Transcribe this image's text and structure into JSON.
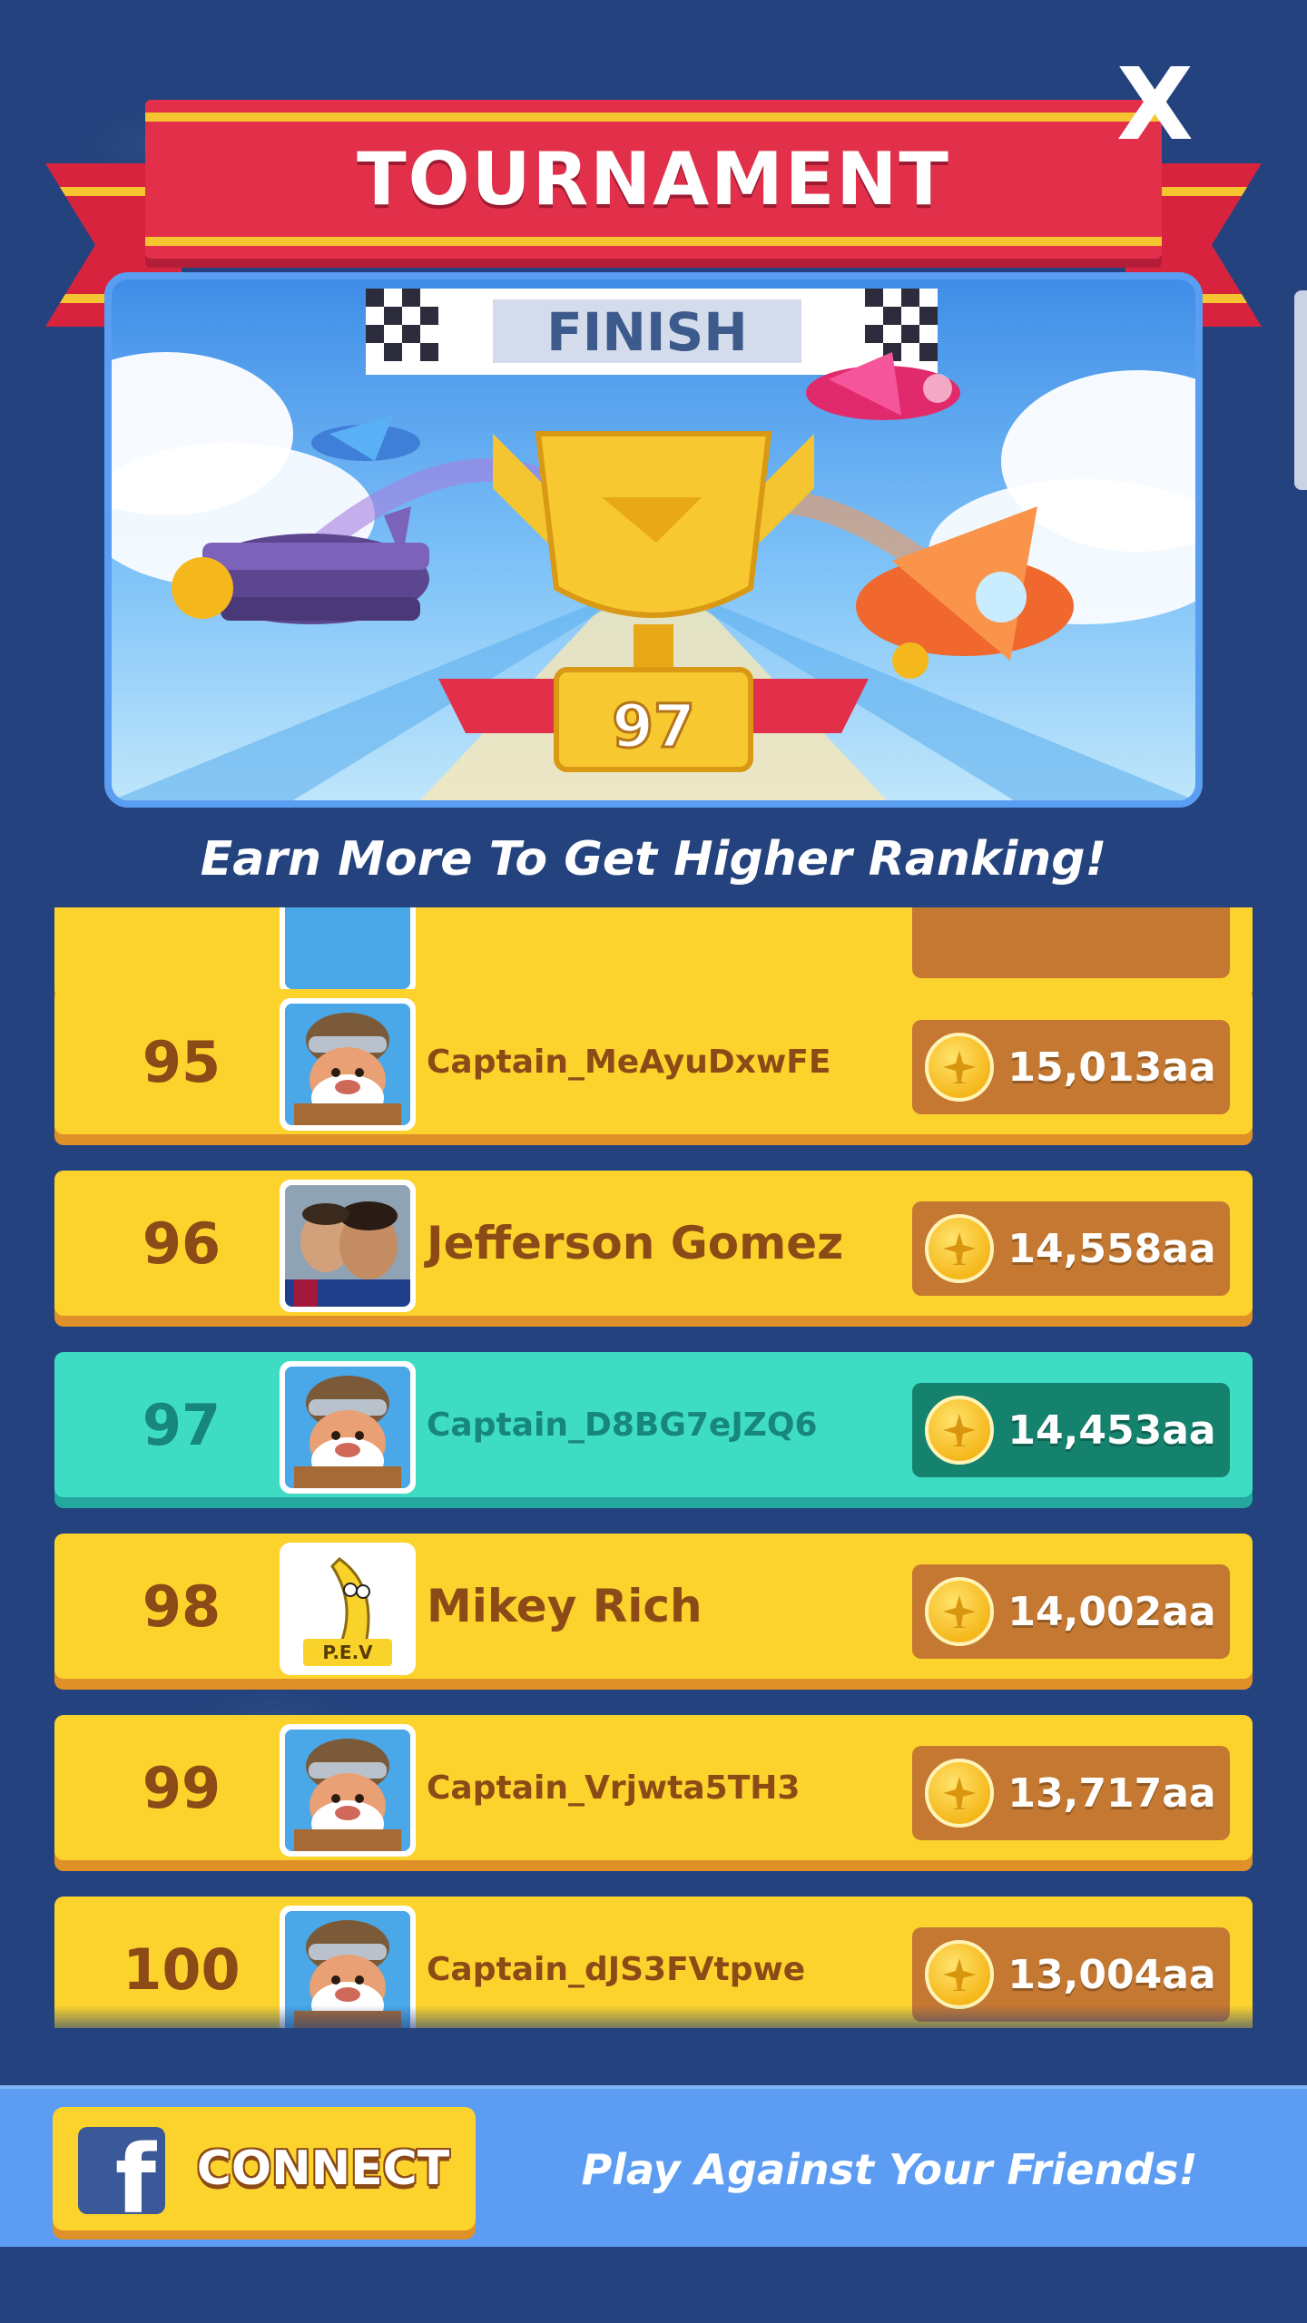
{
  "header": {
    "title": "TOURNAMENT",
    "close_label": "X"
  },
  "banner": {
    "finish_label": "FINISH",
    "player_rank": "97"
  },
  "subtitle": "Earn More To Get Higher Ranking!",
  "leaderboard": {
    "rows": [
      {
        "rank": "95",
        "name": "Captain_MeAyuDxwFE",
        "score": "15,013aa",
        "avatar": "captain-avatar",
        "highlight": false
      },
      {
        "rank": "96",
        "name": "Jefferson Gomez",
        "score": "14,558aa",
        "avatar": "photo-avatar",
        "highlight": false
      },
      {
        "rank": "97",
        "name": "Captain_D8BG7eJZQ6",
        "score": "14,453aa",
        "avatar": "captain-avatar",
        "highlight": true
      },
      {
        "rank": "98",
        "name": "Mikey Rich",
        "score": "14,002aa",
        "avatar": "banana-avatar",
        "highlight": false
      },
      {
        "rank": "99",
        "name": "Captain_Vrjwta5TH3",
        "score": "13,717aa",
        "avatar": "captain-avatar",
        "highlight": false
      },
      {
        "rank": "100",
        "name": "Captain_dJS3FVtpwe",
        "score": "13,004aa",
        "avatar": "captain-avatar",
        "highlight": false
      }
    ],
    "banana_avatar_text": "P.E.V"
  },
  "footer": {
    "connect_label": "CONNECT",
    "fb_glyph": "f",
    "friends_text": "Play Against Your Friends!"
  },
  "colors": {
    "background": "#24437e",
    "row_yellow": "#fcd32d",
    "row_highlight": "#3fdcc4",
    "ribbon_red": "#e2304b",
    "score_brown": "#c47831",
    "footer_blue": "#5c9df3"
  }
}
